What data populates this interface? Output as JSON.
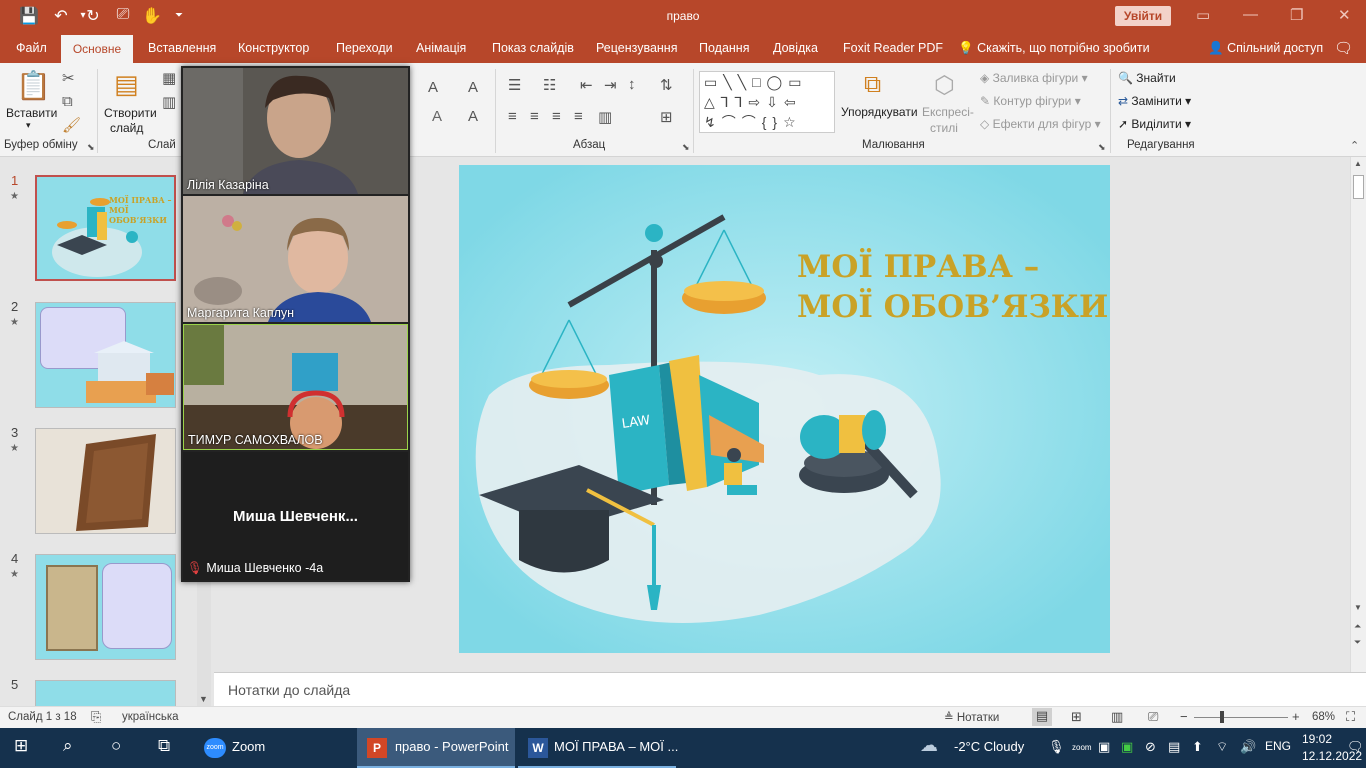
{
  "window": {
    "title": "право",
    "signin": "Увійти"
  },
  "tabs": [
    "Файл",
    "Основне",
    "Вставлення",
    "Конструктор",
    "Переходи",
    "Анімація",
    "Показ слайдів",
    "Рецензування",
    "Подання",
    "Довідка",
    "Foxit Reader PDF"
  ],
  "active_tab": "Основне",
  "tellme": "Скажіть, що потрібно зробити",
  "share": "Спільний доступ",
  "ribbon": {
    "paste": "Вставити",
    "new_slide_1": "Створити",
    "new_slide_2": "слайд",
    "arrange": "Упорядкувати",
    "quick_styles_1": "Експресі-",
    "quick_styles_2": "стилі",
    "shape_fill": "Заливка фігури",
    "shape_outline": "Контур фігури",
    "shape_effects": "Ефекти для фігур",
    "find": "Знайти",
    "replace": "Замінити",
    "select": "Виділити",
    "groups": {
      "clipboard": "Буфер обміну",
      "slides": "Слай",
      "paragraph": "Абзац",
      "drawing": "Малювання",
      "editing": "Редагування"
    }
  },
  "slide": {
    "title_line1": "МОЇ ПРАВА –",
    "title_line2": "МОЇ ОБОВ’ЯЗКИ",
    "book_label": "LAW"
  },
  "thumbnails": [
    {
      "num": "1",
      "title": "МОЇ ПРАВА – МОЇ ОБОВ’ЯЗКИ"
    },
    {
      "num": "2"
    },
    {
      "num": "3"
    },
    {
      "num": "4"
    },
    {
      "num": "5"
    }
  ],
  "zoom": {
    "participants": [
      {
        "name": "Лілія Казаріна"
      },
      {
        "name": "Маргарита Каплун"
      },
      {
        "name": "ТИМУР  САМОХВАЛОВ"
      }
    ],
    "muted_center": "Миша  Шевченк...",
    "muted_name": "Миша Шевченко -4а"
  },
  "notes_placeholder": "Нотатки до слайда",
  "status": {
    "slide": "Слайд 1 з 18",
    "language": "українська",
    "notes": "Нотатки",
    "zoom": "68%"
  },
  "taskbar": {
    "apps": [
      "Zoom",
      "право - PowerPoint",
      "МОЇ ПРАВА – МОЇ ..."
    ],
    "weather": "-2°C  Cloudy",
    "lang": "ENG",
    "time": "19:02",
    "date": "12.12.2022"
  }
}
